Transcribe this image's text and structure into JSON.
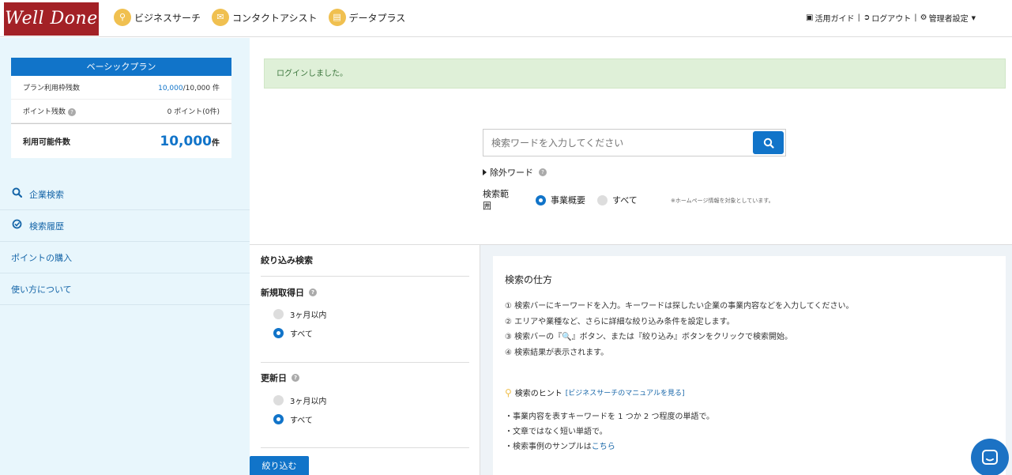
{
  "header": {
    "logo": "Well Done",
    "nav": [
      {
        "label": "ビジネスサーチ",
        "icon": "search-icon"
      },
      {
        "label": "コンタクトアシスト",
        "icon": "mail-icon"
      },
      {
        "label": "データプラス",
        "icon": "document-icon"
      }
    ],
    "links": {
      "guide": "活用ガイド",
      "logout": "ログアウト",
      "admin": "管理者設定"
    }
  },
  "plan": {
    "title": "ベーシックプラン",
    "remaining_label": "プラン利用枠残数",
    "remaining_value": "10,000",
    "remaining_total": "/10,000 件",
    "points_label": "ポイント残数",
    "points_value": "0 ポイント(0件)",
    "available_label": "利用可能件数",
    "available_value": "10,000",
    "available_unit": "件"
  },
  "sidebar": {
    "items": [
      {
        "label": "企業検索",
        "icon": "search-icon"
      },
      {
        "label": "検索履歴",
        "icon": "history-icon"
      },
      {
        "label": "ポイントの購入"
      },
      {
        "label": "使い方について"
      }
    ]
  },
  "alert": "ログインしました。",
  "search": {
    "placeholder": "検索ワードを入力してください",
    "exclude_label": "除外ワード",
    "scope_label": "検索範囲",
    "scope_options": [
      "事業概要",
      "すべて"
    ],
    "scope_selected": "事業概要",
    "scope_note": "※ホームページ情報を対象としています。"
  },
  "filter": {
    "title": "絞り込み検索",
    "acquired": {
      "label": "新規取得日",
      "options": [
        "3ヶ月以内",
        "すべて"
      ],
      "selected": "すべて"
    },
    "updated": {
      "label": "更新日",
      "options": [
        "3ヶ月以内",
        "すべて"
      ],
      "selected": "すべて"
    },
    "button": "絞り込む"
  },
  "howto": {
    "title": "検索の仕方",
    "steps": [
      "① 検索バーにキーワードを入力。キーワードは探したい企業の事業内容などを入力してください。",
      "② エリアや業種など、さらに詳細な絞り込み条件を設定します。",
      "③ 検索バーの『🔍』ボタン、または『絞り込み』ボタンをクリックで検索開始。",
      "④ 検索結果が表示されます。"
    ],
    "hint_title": "検索のヒント",
    "hint_link": "[ビジネスサーチのマニュアルを見る]",
    "tips": [
      "・事業内容を表すキーワードを 1 つか 2 つ程度の単語で。",
      "・文章ではなく短い単語で。"
    ],
    "tip3_prefix": "・検索事例のサンプルは",
    "tip3_link": "こちら"
  }
}
